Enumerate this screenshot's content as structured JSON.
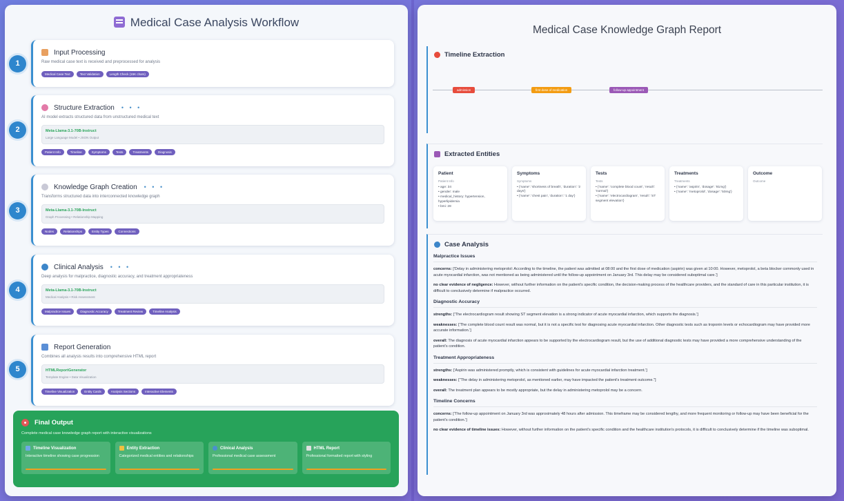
{
  "left": {
    "title": "Medical Case Analysis Workflow",
    "steps": [
      {
        "number": "1",
        "title": "Input Processing",
        "description": "Raw medical case text is received and preprocessed for analysis",
        "tags": [
          "Medical Case Text",
          "Text Validation",
          "Length Check (15K chars)"
        ]
      },
      {
        "number": "2",
        "title": "Structure Extraction",
        "dots": "• • •",
        "description": "AI model extracts structured data from unstructured medical text",
        "model_name": "Meta-Llama-3.1-70B-Instruct",
        "model_sub": "Large Language Model • JSON Output",
        "tags": [
          "Patient Info",
          "Timeline",
          "Symptoms",
          "Tests",
          "Treatments",
          "Diagnosis"
        ]
      },
      {
        "number": "3",
        "title": "Knowledge Graph Creation",
        "dots": "• • •",
        "description": "Transforms structured data into interconnected knowledge graph",
        "model_name": "Meta-Llama-3.1-70B-Instruct",
        "model_sub": "Graph Processing • Relationship Mapping",
        "tags": [
          "Nodes",
          "Relationships",
          "Entity Types",
          "Connections"
        ]
      },
      {
        "number": "4",
        "title": "Clinical Analysis",
        "dots": "• • •",
        "description": "Deep analysis for malpractice, diagnostic accuracy, and treatment appropriateness",
        "model_name": "Meta-Llama-3.1-70B-Instruct",
        "model_sub": "Medical Analysis • Risk Assessment",
        "tags": [
          "Malpractice Issues",
          "Diagnostic Accuracy",
          "Treatment Review",
          "Timeline Analysis"
        ]
      },
      {
        "number": "5",
        "title": "Report Generation",
        "description": "Combines all analysis results into comprehensive HTML report",
        "model_name": "HTMLReportGenerator",
        "model_sub": "Template Engine • Data Visualization",
        "tags": [
          "Timeline Visualization",
          "Entity Cards",
          "Analysis Sections",
          "Interactive Elements"
        ]
      }
    ],
    "final": {
      "title": "Final Output",
      "description": "Complete medical case knowledge graph report with interactive visualizations",
      "cards": [
        {
          "title": "Timeline Visualization",
          "description": "Interactive timeline showing case progression"
        },
        {
          "title": "Entity Extraction",
          "description": "Categorized medical entities and relationships"
        },
        {
          "title": "Clinical Analysis",
          "description": "Professional medical case assessment"
        },
        {
          "title": "HTML Report",
          "description": "Professional formatted report with styling"
        }
      ]
    }
  },
  "right": {
    "title": "Medical Case Knowledge Graph Report",
    "timeline": {
      "title": "Timeline Extraction",
      "events": [
        {
          "label": "admission",
          "color": "#e74c3c"
        },
        {
          "label": "first dose of medication",
          "color": "#f39c12"
        },
        {
          "label": "follow-up appointment",
          "color": "#9b59b6"
        }
      ]
    },
    "entities": {
      "title": "Extracted Entities",
      "cards": [
        {
          "title": "Patient",
          "subtitle": "Patient Info",
          "items": [
            "age: 34",
            "gender: male",
            "medical_history: hypertension, hyperlipidemia",
            "bmi: 28"
          ]
        },
        {
          "title": "Symptoms",
          "subtitle": "Symptoms",
          "items": [
            "{'name': 'shortness of breath', 'duration': '2 days'}",
            "{'name': 'chest pain', 'duration': '1 day'}"
          ]
        },
        {
          "title": "Tests",
          "subtitle": "Tests",
          "items": [
            "{'name': 'complete blood count', 'result': 'normal'}",
            "{'name': 'electrocardiogram', 'result': 'ST segment elevation'}"
          ]
        },
        {
          "title": "Treatments",
          "subtitle": "Treatments",
          "items": [
            "{'name': 'aspirin', 'dosage': '81mg'}",
            "{'name': 'metoprolol', 'dosage': '50mg'}"
          ]
        },
        {
          "title": "Outcome",
          "subtitle": "Outcome",
          "items": []
        }
      ]
    },
    "analysis": {
      "title": "Case Analysis",
      "sections": [
        {
          "heading": "Malpractice Issues",
          "paragraphs": [
            {
              "label": "concerns:",
              "text": "['Delay in administering metoprolol: According to the timeline, the patient was admitted at 08:00 and the first dose of medication (aspirin) was given at 10:00. However, metoprolol, a beta blocker commonly used in acute myocardial infarction, was not mentioned as being administered until the follow-up appointment on January 3rd. This delay may be considered suboptimal care.']"
            },
            {
              "label": "no clear evidence of negligence:",
              "text": "However, without further information on the patient's specific condition, the decision-making process of the healthcare providers, and the standard of care in this particular institution, it is difficult to conclusively determine if malpractice occurred."
            }
          ]
        },
        {
          "heading": "Diagnostic Accuracy",
          "paragraphs": [
            {
              "label": "strengths:",
              "text": "['The electrocardiogram result showing ST segment elevation is a strong indicator of acute myocardial infarction, which supports the diagnosis.']"
            },
            {
              "label": "weaknesses:",
              "text": "['The complete blood count result was normal, but it is not a specific test for diagnosing acute myocardial infarction. Other diagnostic tests such as troponin levels or echocardiogram may have provided more accurate information.']"
            },
            {
              "label": "overall:",
              "text": "The diagnosis of acute myocardial infarction appears to be supported by the electrocardiogram result, but the use of additional diagnostic tests may have provided a more comprehensive understanding of the patient's condition."
            }
          ]
        },
        {
          "heading": "Treatment Appropriateness",
          "paragraphs": [
            {
              "label": "strengths:",
              "text": "['Aspirin was administered promptly, which is consistent with guidelines for acute myocardial infarction treatment.']"
            },
            {
              "label": "weaknesses:",
              "text": "[\"The delay in administering metoprolol, as mentioned earlier, may have impacted the patient's treatment outcome.\"]"
            },
            {
              "label": "overall:",
              "text": "The treatment plan appears to be mostly appropriate, but the delay in administering metoprolol may be a concern."
            }
          ]
        },
        {
          "heading": "Timeline Concerns",
          "paragraphs": [
            {
              "label": "concerns:",
              "text": "['The follow-up appointment on January 3rd was approximately 48 hours after admission. This timeframe may be considered lengthy, and more frequent monitoring or follow-up may have been beneficial for the patient's condition.']"
            },
            {
              "label": "no clear evidence of timeline issues:",
              "text": "However, without further information on the patient's specific condition and the healthcare institution's protocols, it is difficult to conclusively determine if the timeline was suboptimal."
            }
          ]
        }
      ]
    }
  }
}
